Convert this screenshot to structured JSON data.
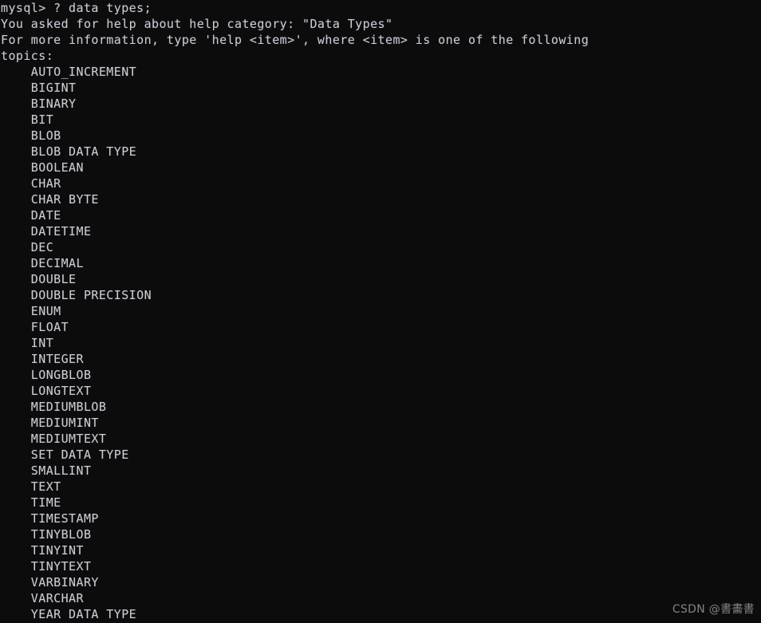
{
  "terminal": {
    "background_color": "#0c0c0c",
    "text_color": "#c9ccd3",
    "prompt_line": "mysql> ? data types;",
    "message_lines": [
      "You asked for help about help category: \"Data Types\"",
      "For more information, type 'help <item>', where <item> is one of the following",
      "topics:"
    ],
    "topics_indent": "    ",
    "topics": [
      "AUTO_INCREMENT",
      "BIGINT",
      "BINARY",
      "BIT",
      "BLOB",
      "BLOB DATA TYPE",
      "BOOLEAN",
      "CHAR",
      "CHAR BYTE",
      "DATE",
      "DATETIME",
      "DEC",
      "DECIMAL",
      "DOUBLE",
      "DOUBLE PRECISION",
      "ENUM",
      "FLOAT",
      "INT",
      "INTEGER",
      "LONGBLOB",
      "LONGTEXT",
      "MEDIUMBLOB",
      "MEDIUMINT",
      "MEDIUMTEXT",
      "SET DATA TYPE",
      "SMALLINT",
      "TEXT",
      "TIME",
      "TIMESTAMP",
      "TINYBLOB",
      "TINYINT",
      "TINYTEXT",
      "VARBINARY",
      "VARCHAR",
      "YEAR DATA TYPE"
    ]
  },
  "watermark": {
    "text": "CSDN @書畵書",
    "color": "#8d8d8d"
  }
}
